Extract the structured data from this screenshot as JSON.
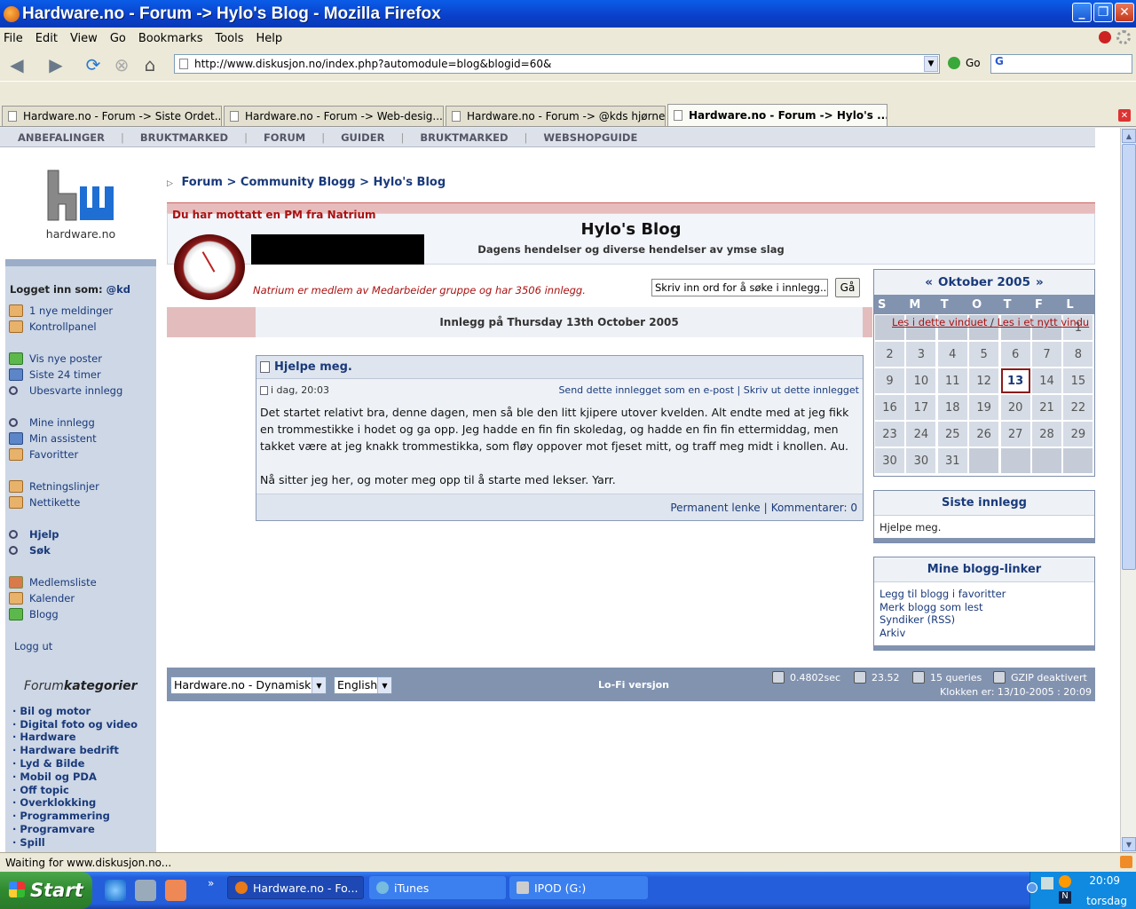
{
  "window": {
    "title": "Hardware.no - Forum -> Hylo's Blog - Mozilla Firefox",
    "buttons": {
      "minimize": "_",
      "maximize": "❐",
      "close": "✕"
    }
  },
  "menubar": [
    "File",
    "Edit",
    "View",
    "Go",
    "Bookmarks",
    "Tools",
    "Help"
  ],
  "navbar": {
    "url": "http://www.diskusjon.no/index.php?automodule=blog&blogid=60&",
    "go_label": "Go",
    "search_value": "G"
  },
  "tabs": [
    {
      "label": "Hardware.no - Forum -> Siste Ordet..."
    },
    {
      "label": "Hardware.no - Forum -> Web-desig..."
    },
    {
      "label": "Hardware.no - Forum -> @kds hjørne"
    },
    {
      "label": "Hardware.no - Forum -> Hylo's ..."
    }
  ],
  "site_nav": [
    "ANBEFALINGER",
    "BRUKTMARKED",
    "FORUM",
    "GUIDER",
    "BRUKTMARKED",
    "WEBSHOPGUIDE"
  ],
  "logo": {
    "text": "hardware.no"
  },
  "sidebar": {
    "logged_in_label": "Logget inn som:",
    "user": "@kd",
    "group1": [
      {
        "label": "1 nye meldinger",
        "icon": "folder-icon"
      },
      {
        "label": "Kontrollpanel",
        "icon": "folder-icon"
      }
    ],
    "group2": [
      {
        "label": "Vis nye poster",
        "icon": "envelope-icon"
      },
      {
        "label": "Siste 24 timer",
        "icon": "clock-icon"
      },
      {
        "label": "Ubesvarte innlegg",
        "icon": "search-icon"
      }
    ],
    "group3": [
      {
        "label": "Mine innlegg",
        "icon": "search-icon"
      },
      {
        "label": "Min assistent",
        "icon": "window-icon"
      },
      {
        "label": "Favoritter",
        "icon": "folder-icon"
      }
    ],
    "group4": [
      {
        "label": "Retningslinjer",
        "icon": "folder-icon"
      },
      {
        "label": "Nettikette",
        "icon": "folder-icon"
      }
    ],
    "group5": [
      {
        "label": "Hjelp",
        "icon": "search-icon"
      },
      {
        "label": "Søk",
        "icon": "search-icon"
      }
    ],
    "group6": [
      {
        "label": "Medlemsliste",
        "icon": "people-icon"
      },
      {
        "label": "Kalender",
        "icon": "folder-icon"
      },
      {
        "label": "Blogg",
        "icon": "envelope-icon"
      }
    ],
    "logout": "Logg ut",
    "forum_title_a": "Forum",
    "forum_title_b": "kategorier",
    "categories": [
      "Bil og motor",
      "Digital foto og video",
      "Hardware",
      "Hardware bedrift",
      "Lyd & Bilde",
      "Mobil og PDA",
      "Off topic",
      "Overklokking",
      "Programmering",
      "Programvare",
      "Spill"
    ]
  },
  "breadcrumb": {
    "a": "Forum",
    "sep1": ">",
    "b": "Community Blogg",
    "sep2": ">",
    "c": "Hylo's Blog"
  },
  "pm_notice": "Du har mottatt en PM fra Natrium",
  "blog": {
    "title": "Hylo's Blog",
    "subtitle": "Dagens hendelser og diverse hendelser av ymse slag",
    "member_info": "Natrium er medlem av Medarbeider gruppe og har 3506 innlegg.",
    "search_placeholder": "Skriv inn ord for å søke i innlegg...",
    "search_button": "Gå",
    "date_header": "Innlegg på Thursday 13th October 2005"
  },
  "post": {
    "title": "Hjelpe meg.",
    "time": "i dag, 20:03",
    "send_link": "Send dette innlegget som en e-post",
    "sep": "|",
    "print_link": "Skriv ut dette innlegget",
    "body1": "Det startet relativt bra, denne dagen, men så ble den litt kjipere utover kvelden. Alt endte med at jeg fikk en trommestikke i hodet og ga opp. Jeg hadde en fin fin skoledag, og hadde en fin fin ettermiddag, men takket være at jeg knakk trommestikka, som fløy oppover mot fjeset mitt, og traff meg midt i knollen. Au.",
    "body2": "Nå sitter jeg her, og moter meg opp til å starte med lekser. Yarr.",
    "permalink": "Permanent lenke",
    "comments": "Kommentarer: 0"
  },
  "calendar": {
    "prev": "«",
    "month": "Oktober 2005",
    "next": "»",
    "dow": [
      "S",
      "M",
      "T",
      "O",
      "T",
      "F",
      "L"
    ],
    "row1": [
      "",
      "",
      "",
      "",
      "",
      "",
      "1"
    ],
    "row2": [
      "2",
      "3",
      "4",
      "5",
      "6",
      "7",
      "8"
    ],
    "row3": [
      "9",
      "10",
      "11",
      "12",
      "13",
      "14",
      "15"
    ],
    "row4": [
      "16",
      "17",
      "18",
      "19",
      "20",
      "21",
      "22"
    ],
    "row5": [
      "23",
      "24",
      "25",
      "26",
      "27",
      "28",
      "29"
    ],
    "row6": [
      "30",
      "30",
      "31",
      "",
      "",
      "",
      ""
    ],
    "today": "13",
    "tooltip_a": "Les i dette vinduet",
    "tooltip_sep": "/",
    "tooltip_b": "Les i et nytt vindu"
  },
  "recent": {
    "title": "Siste innlegg",
    "items": [
      "Hjelpe meg."
    ]
  },
  "links": {
    "title": "Mine blogg-linker",
    "items": [
      "Legg til blogg i favoritter",
      "Merk blogg som lest",
      "Syndiker (RSS)",
      "Arkiv"
    ]
  },
  "footer": {
    "skin": "Hardware.no - Dynamisk",
    "lang": "English",
    "lofi": "Lo-Fi versjon",
    "time": "0.4802sec",
    "load": "23.52",
    "queries": "15 queries",
    "gzip": "GZIP deaktivert",
    "clock": "Klokken er: 13/10-2005 : 20:09"
  },
  "status": "Waiting for www.diskusjon.no...",
  "taskbar": {
    "start": "Start",
    "items": [
      "Hardware.no - Fo...",
      "iTunes",
      "IPOD (G:)"
    ],
    "time": "20:09",
    "day": "torsdag"
  }
}
